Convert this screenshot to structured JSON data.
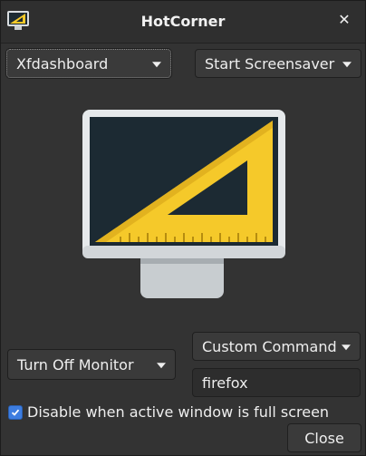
{
  "window": {
    "title": "HotCorner",
    "close_icon": "close-icon",
    "app_icon": "hotcorner-app-icon"
  },
  "corners": {
    "top_left": {
      "selected": "Xfdashboard"
    },
    "top_right": {
      "selected": "Start Screensaver"
    },
    "bottom_left": {
      "selected": "Turn Off Monitor"
    },
    "bottom_right": {
      "selected": "Custom Command",
      "command_value": "firefox"
    }
  },
  "preview": {
    "icon": "monitor-with-set-square-icon"
  },
  "options": {
    "fullscreen_label": "Disable when active window is full screen",
    "fullscreen_checked": true
  },
  "footer": {
    "close_label": "Close"
  },
  "colors": {
    "background": "#333333",
    "accent": "#3d7de0",
    "ruler_yellow": "#f5c92a",
    "screen_dark": "#1c2a33"
  }
}
